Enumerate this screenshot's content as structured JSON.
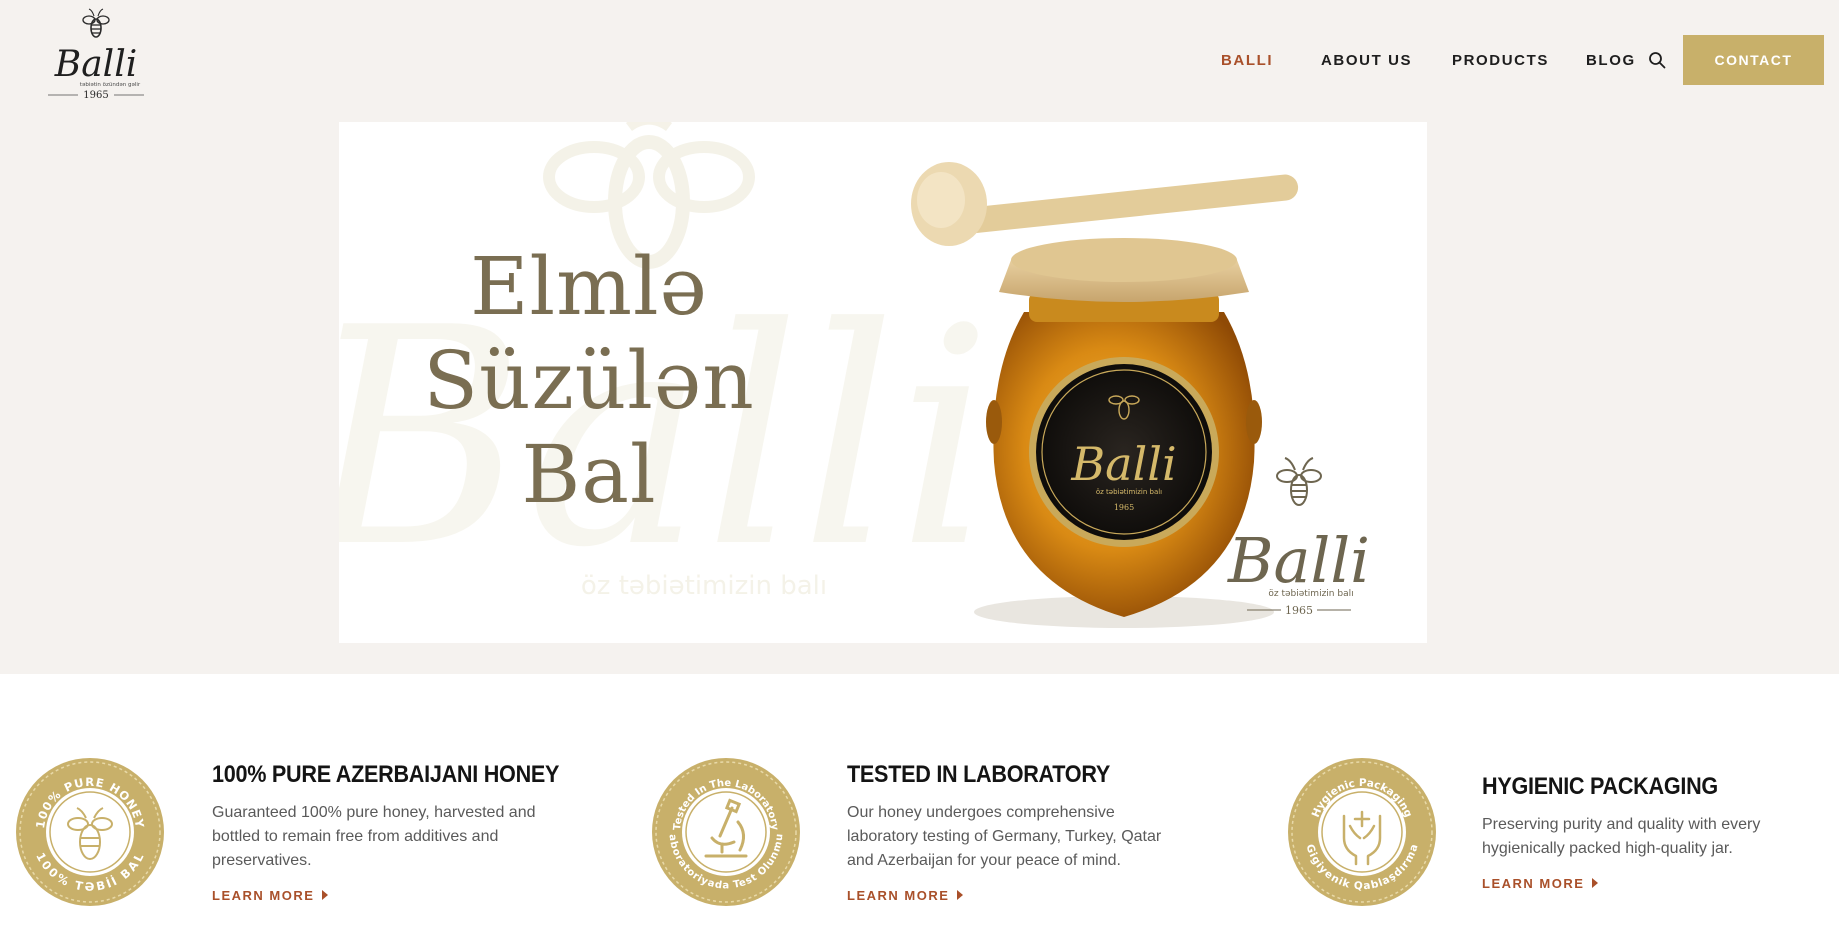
{
  "brand": {
    "logo_text": "Balli",
    "tagline": "təbiətin özündən gəlir",
    "year": "1965"
  },
  "nav": {
    "items": [
      {
        "label": "BALLI",
        "active": true
      },
      {
        "label": "ABOUT US",
        "active": false
      },
      {
        "label": "PRODUCTS",
        "active": false
      },
      {
        "label": "BLOG",
        "active": false
      }
    ],
    "search_icon": "search-icon",
    "contact_label": "CONTACT"
  },
  "hero": {
    "title_lines": [
      "Elmlə",
      "Süzülən",
      "Bal"
    ],
    "watermark_tagline": "öz  təbiətimizin balı",
    "jar_label_brand": "Balli",
    "jar_label_tagline": "öz təbiətimizin balı",
    "jar_label_year": "1965",
    "logo_brand": "Balli",
    "logo_tagline": "öz  təbiətimizin balı",
    "logo_year": "1965"
  },
  "features": [
    {
      "title": "100% PURE AZERBAIJANI HONEY",
      "description": "Guaranteed 100% pure honey, harvested and bottled to remain free from additives and preservatives.",
      "link": "LEARN MORE",
      "badge_top": "100% PURE HONEY",
      "badge_bottom": "100% TƏBİİ BAL",
      "badge_icon": "bee-icon"
    },
    {
      "title": "TESTED IN LABORATORY",
      "description": "Our honey undergoes comprehensive laboratory testing of Germany, Turkey, Qatar and Azerbaijan for your peace of mind.",
      "link": "LEARN MORE",
      "badge_top": "Tested In The Laboratory",
      "badge_bottom": "Laboratoriyada Test Olunmuş",
      "badge_icon": "microscope-icon"
    },
    {
      "title": "HYGIENIC PACKAGING",
      "description": "Preserving purity and quality with every hygienically packed high-quality jar.",
      "link": "LEARN MORE",
      "badge_top": "Hygienic Packaging",
      "badge_bottom": "Gigiyenik Qablaşdırma",
      "badge_icon": "hands-cross-icon"
    }
  ],
  "colors": {
    "background": "#f5f2ef",
    "accent": "#a9502a",
    "gold": "#c8b06a",
    "hero_text": "#7a6e52"
  }
}
